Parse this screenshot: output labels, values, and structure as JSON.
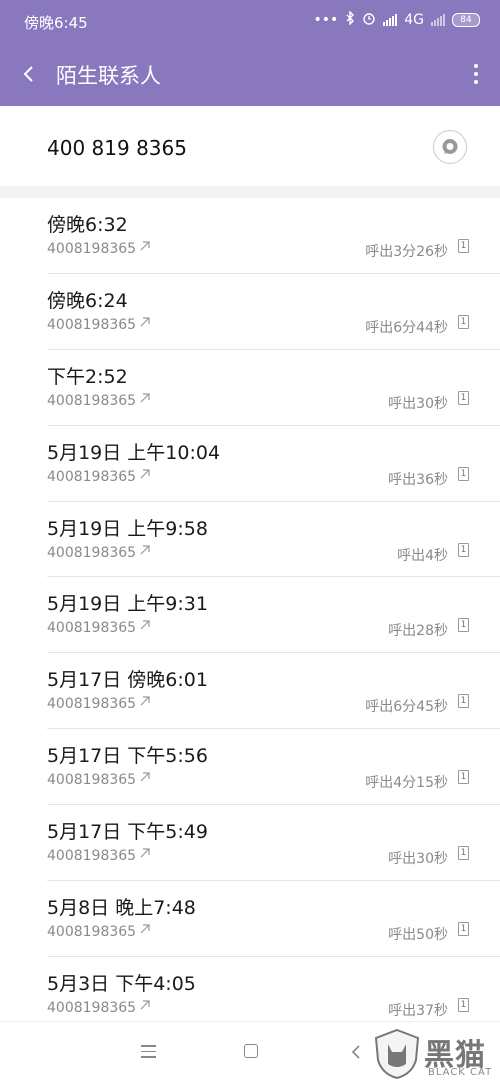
{
  "status_bar": {
    "time": "傍晚6:45",
    "dots": "•••",
    "network": "4G",
    "battery": "84"
  },
  "app_bar": {
    "title": "陌生联系人"
  },
  "contact": {
    "number": "400 819 8365"
  },
  "calls": [
    {
      "datetime": "傍晚6:32",
      "number": "4008198365",
      "duration": "呼出3分26秒",
      "sim": "1"
    },
    {
      "datetime": "傍晚6:24",
      "number": "4008198365",
      "duration": "呼出6分44秒",
      "sim": "1"
    },
    {
      "datetime": "下午2:52",
      "number": "4008198365",
      "duration": "呼出30秒",
      "sim": "1"
    },
    {
      "datetime": "5月19日 上午10:04",
      "number": "4008198365",
      "duration": "呼出36秒",
      "sim": "1"
    },
    {
      "datetime": "5月19日 上午9:58",
      "number": "4008198365",
      "duration": "呼出4秒",
      "sim": "1"
    },
    {
      "datetime": "5月19日 上午9:31",
      "number": "4008198365",
      "duration": "呼出28秒",
      "sim": "1"
    },
    {
      "datetime": "5月17日 傍晚6:01",
      "number": "4008198365",
      "duration": "呼出6分45秒",
      "sim": "1"
    },
    {
      "datetime": "5月17日 下午5:56",
      "number": "4008198365",
      "duration": "呼出4分15秒",
      "sim": "1"
    },
    {
      "datetime": "5月17日 下午5:49",
      "number": "4008198365",
      "duration": "呼出30秒",
      "sim": "1"
    },
    {
      "datetime": "5月8日 晚上7:48",
      "number": "4008198365",
      "duration": "呼出50秒",
      "sim": "1"
    },
    {
      "datetime": "5月3日 下午4:05",
      "number": "4008198365",
      "duration": "呼出37秒",
      "sim": "1"
    }
  ],
  "watermark": {
    "text": "黑猫",
    "sub": "BLACK CAT"
  },
  "colors": {
    "accent": "#8a78bf"
  }
}
